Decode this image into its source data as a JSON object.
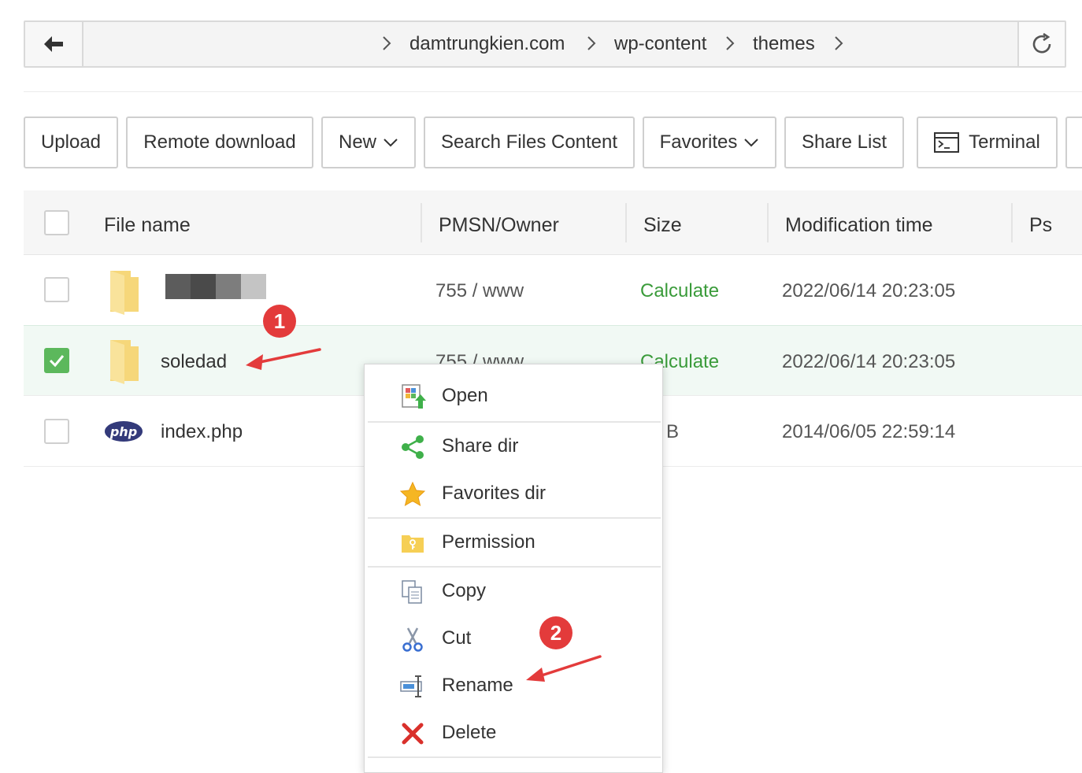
{
  "breadcrumb": {
    "items": [
      "damtrungkien.com",
      "wp-content",
      "themes"
    ]
  },
  "toolbar": {
    "upload": "Upload",
    "remote_download": "Remote download",
    "new": "New",
    "search_files": "Search Files Content",
    "favorites": "Favorites",
    "share_list": "Share List",
    "terminal": "Terminal"
  },
  "table": {
    "headers": {
      "name": "File name",
      "perm": "PMSN/Owner",
      "size": "Size",
      "mtime": "Modification time",
      "ps": "Ps"
    },
    "rows": [
      {
        "name": "",
        "perm": "755 / www",
        "size": "Calculate",
        "mtime": "2022/06/14 20:23:05",
        "checked": false,
        "type": "folder"
      },
      {
        "name": "soledad",
        "perm": "755 / www",
        "size": "Calculate",
        "mtime": "2022/06/14 20:23:05",
        "checked": true,
        "type": "folder"
      },
      {
        "name": "index.php",
        "size": "B",
        "mtime": "2014/06/05 22:59:14",
        "checked": false,
        "type": "php"
      }
    ]
  },
  "context_menu": {
    "open": "Open",
    "share_dir": "Share dir",
    "favorites_dir": "Favorites dir",
    "permission": "Permission",
    "copy": "Copy",
    "cut": "Cut",
    "rename": "Rename",
    "delete": "Delete"
  },
  "annotations": {
    "badge1": "1",
    "badge2": "2"
  },
  "colors": {
    "accent_green": "#3a9b3a",
    "check_green": "#5cb85c",
    "badge_red": "#e33b3b",
    "folder_yellow": "#f6d77a"
  },
  "icons": {
    "php_logo": "php"
  }
}
